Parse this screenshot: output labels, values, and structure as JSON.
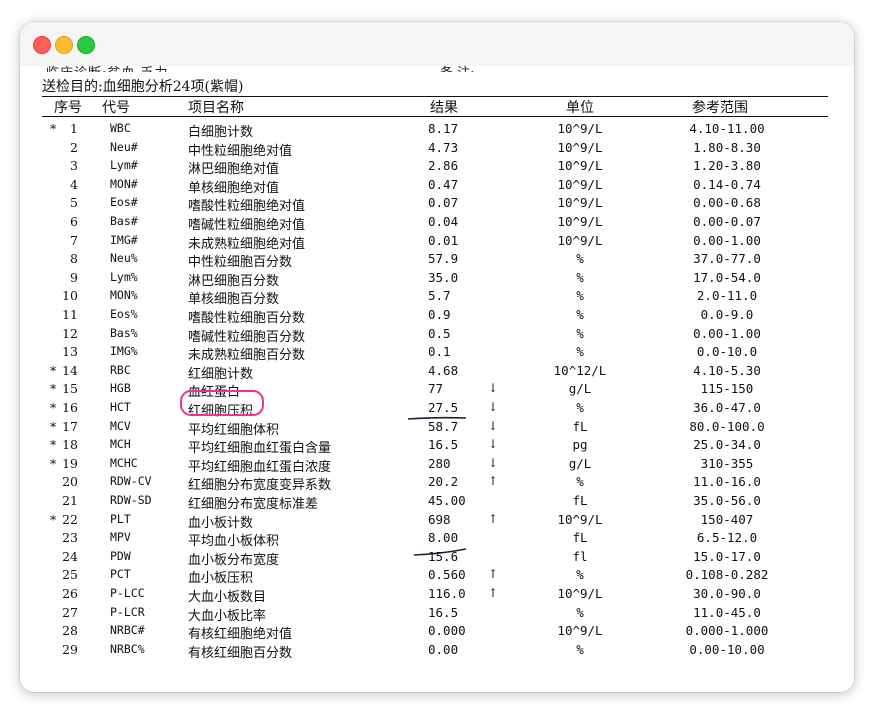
{
  "window": {
    "controls": [
      "close",
      "minimize",
      "zoom"
    ]
  },
  "document": {
    "cut_off_line": "临床诊断:贫血,乏力",
    "cut_off_right": "备  注:",
    "purpose": "送检目的:血细胞分析24项(紫帽)",
    "headers": {
      "no": "序号",
      "code": "代号",
      "name": "项目名称",
      "result": "结果",
      "unit": "单位",
      "ref": "参考范围"
    },
    "rows": [
      {
        "star": "*",
        "no": "1",
        "code": "WBC",
        "name": "白细胞计数",
        "result": "8.17",
        "flag": "",
        "unit": "10^9/L",
        "ref": "4.10-11.00"
      },
      {
        "star": "",
        "no": "2",
        "code": "Neu#",
        "name": "中性粒细胞绝对值",
        "result": "4.73",
        "flag": "",
        "unit": "10^9/L",
        "ref": "1.80-8.30"
      },
      {
        "star": "",
        "no": "3",
        "code": "Lym#",
        "name": "淋巴细胞绝对值",
        "result": "2.86",
        "flag": "",
        "unit": "10^9/L",
        "ref": "1.20-3.80"
      },
      {
        "star": "",
        "no": "4",
        "code": "MON#",
        "name": "单核细胞绝对值",
        "result": "0.47",
        "flag": "",
        "unit": "10^9/L",
        "ref": "0.14-0.74"
      },
      {
        "star": "",
        "no": "5",
        "code": "Eos#",
        "name": "嗜酸性粒细胞绝对值",
        "result": "0.07",
        "flag": "",
        "unit": "10^9/L",
        "ref": "0.00-0.68"
      },
      {
        "star": "",
        "no": "6",
        "code": "Bas#",
        "name": "嗜碱性粒细胞绝对值",
        "result": "0.04",
        "flag": "",
        "unit": "10^9/L",
        "ref": "0.00-0.07"
      },
      {
        "star": "",
        "no": "7",
        "code": "IMG#",
        "name": "未成熟粒细胞绝对值",
        "result": "0.01",
        "flag": "",
        "unit": "10^9/L",
        "ref": "0.00-1.00"
      },
      {
        "star": "",
        "no": "8",
        "code": "Neu%",
        "name": "中性粒细胞百分数",
        "result": "57.9",
        "flag": "",
        "unit": "%",
        "ref": "37.0-77.0"
      },
      {
        "star": "",
        "no": "9",
        "code": "Lym%",
        "name": "淋巴细胞百分数",
        "result": "35.0",
        "flag": "",
        "unit": "%",
        "ref": "17.0-54.0"
      },
      {
        "star": "",
        "no": "10",
        "code": "MON%",
        "name": "单核细胞百分数",
        "result": "5.7",
        "flag": "",
        "unit": "%",
        "ref": "2.0-11.0"
      },
      {
        "star": "",
        "no": "11",
        "code": "Eos%",
        "name": "嗜酸性粒细胞百分数",
        "result": "0.9",
        "flag": "",
        "unit": "%",
        "ref": "0.0-9.0"
      },
      {
        "star": "",
        "no": "12",
        "code": "Bas%",
        "name": "嗜碱性粒细胞百分数",
        "result": "0.5",
        "flag": "",
        "unit": "%",
        "ref": "0.00-1.00"
      },
      {
        "star": "",
        "no": "13",
        "code": "IMG%",
        "name": "未成熟粒细胞百分数",
        "result": "0.1",
        "flag": "",
        "unit": "%",
        "ref": "0.0-10.0"
      },
      {
        "star": "*",
        "no": "14",
        "code": "RBC",
        "name": "红细胞计数",
        "result": "4.68",
        "flag": "",
        "unit": "10^12/L",
        "ref": "4.10-5.30"
      },
      {
        "star": "*",
        "no": "15",
        "code": "HGB",
        "name": "血红蛋白",
        "result": "77",
        "flag": "↓",
        "unit": "g/L",
        "ref": "115-150"
      },
      {
        "star": "*",
        "no": "16",
        "code": "HCT",
        "name": "红细胞压积",
        "result": "27.5",
        "flag": "↓",
        "unit": "%",
        "ref": "36.0-47.0"
      },
      {
        "star": "*",
        "no": "17",
        "code": "MCV",
        "name": "平均红细胞体积",
        "result": "58.7",
        "flag": "↓",
        "unit": "fL",
        "ref": "80.0-100.0"
      },
      {
        "star": "*",
        "no": "18",
        "code": "MCH",
        "name": "平均红细胞血红蛋白含量",
        "result": "16.5",
        "flag": "↓",
        "unit": "pg",
        "ref": "25.0-34.0"
      },
      {
        "star": "*",
        "no": "19",
        "code": "MCHC",
        "name": "平均红细胞血红蛋白浓度",
        "result": "280",
        "flag": "↓",
        "unit": "g/L",
        "ref": "310-355"
      },
      {
        "star": "",
        "no": "20",
        "code": "RDW-CV",
        "name": "红细胞分布宽度变异系数",
        "result": "20.2",
        "flag": "↑",
        "unit": "%",
        "ref": "11.0-16.0"
      },
      {
        "star": "",
        "no": "21",
        "code": "RDW-SD",
        "name": "红细胞分布宽度标准差",
        "result": "45.00",
        "flag": "",
        "unit": "fL",
        "ref": "35.0-56.0"
      },
      {
        "star": "*",
        "no": "22",
        "code": "PLT",
        "name": "血小板计数",
        "result": "698",
        "flag": "↑",
        "unit": "10^9/L",
        "ref": "150-407"
      },
      {
        "star": "",
        "no": "23",
        "code": "MPV",
        "name": "平均血小板体积",
        "result": "8.00",
        "flag": "",
        "unit": "fL",
        "ref": "6.5-12.0"
      },
      {
        "star": "",
        "no": "24",
        "code": "PDW",
        "name": "血小板分布宽度",
        "result": "15.6",
        "flag": "",
        "unit": "fl",
        "ref": "15.0-17.0"
      },
      {
        "star": "",
        "no": "25",
        "code": "PCT",
        "name": "血小板压积",
        "result": "0.560",
        "flag": "↑",
        "unit": "%",
        "ref": "0.108-0.282"
      },
      {
        "star": "",
        "no": "26",
        "code": "P-LCC",
        "name": "大血小板数目",
        "result": "116.0",
        "flag": "↑",
        "unit": "10^9/L",
        "ref": "30.0-90.0"
      },
      {
        "star": "",
        "no": "27",
        "code": "P-LCR",
        "name": "大血小板比率",
        "result": "16.5",
        "flag": "",
        "unit": "%",
        "ref": "11.0-45.0"
      },
      {
        "star": "",
        "no": "28",
        "code": "NRBC#",
        "name": "有核红细胞绝对值",
        "result": "0.000",
        "flag": "",
        "unit": "10^9/L",
        "ref": "0.000-1.000"
      },
      {
        "star": "",
        "no": "29",
        "code": "NRBC%",
        "name": "有核红细胞百分数",
        "result": "0.00",
        "flag": "",
        "unit": "%",
        "ref": "0.00-10.00"
      }
    ]
  },
  "annotations": {
    "highlight_color": "#e8358f",
    "pen_color": "#1a1f3a"
  }
}
